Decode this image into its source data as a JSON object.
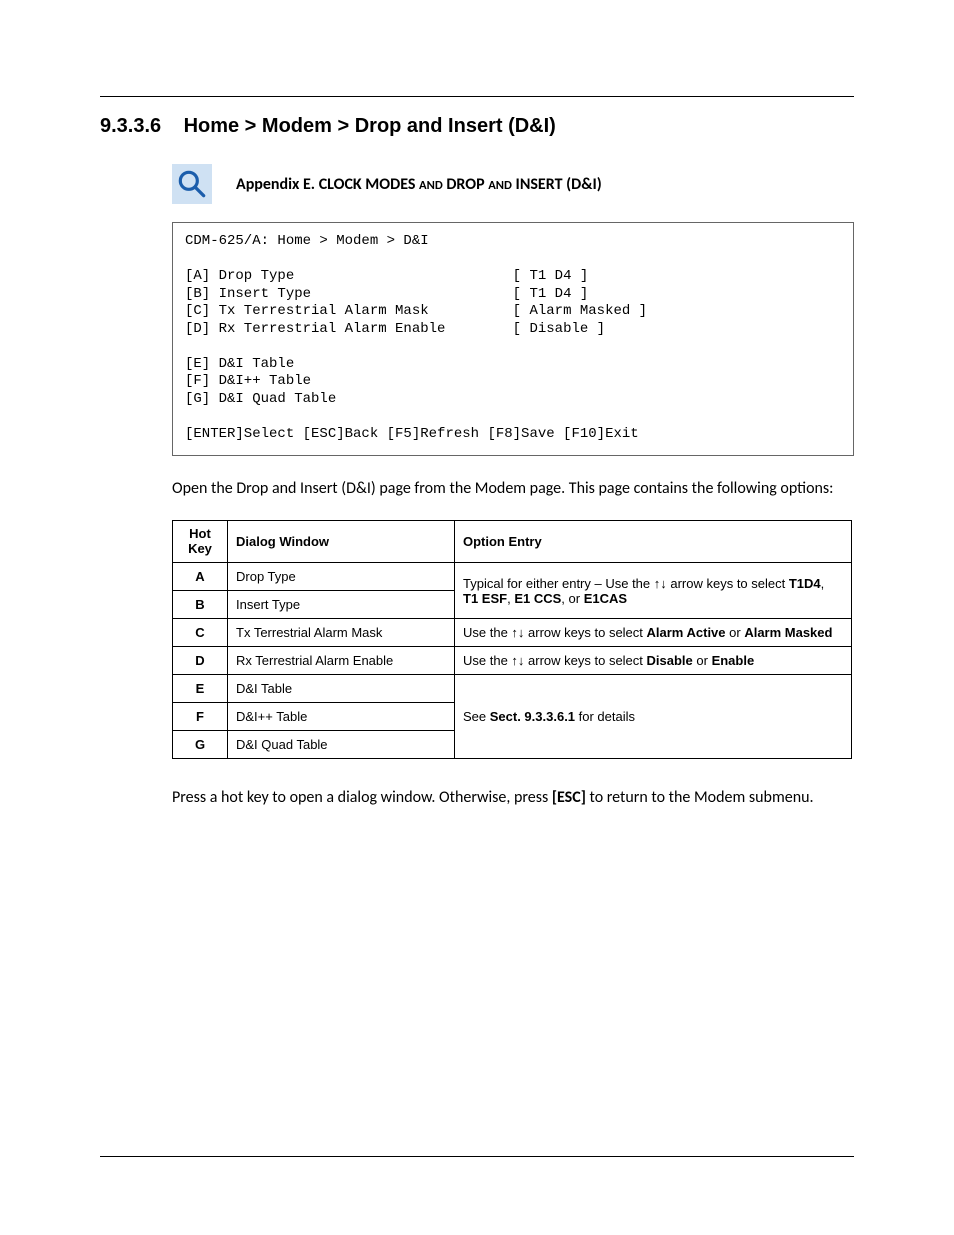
{
  "heading": {
    "number": "9.3.3.6",
    "title": "Home > Modem > Drop and Insert (D&I)"
  },
  "appendix": {
    "prefix": "Appendix E. CLOCK MODES ",
    "and1": "AND",
    "mid": " DROP ",
    "and2": "AND",
    "suffix": " INSERT (D&I)"
  },
  "terminal": {
    "line1": "CDM-625/A: Home > Modem > D&I",
    "blank": "",
    "rowA_label": "[A] Drop Type",
    "rowA_val": "[ T1 D4 ]",
    "rowB_label": "[B] Insert Type",
    "rowB_val": "[ T1 D4 ]",
    "rowC_label": "[C] Tx Terrestrial Alarm Mask",
    "rowC_val": "[ Alarm Masked ]",
    "rowD_label": "[D] Rx Terrestrial Alarm Enable",
    "rowD_val": "[ Disable ]",
    "rowE": "[E] D&I Table",
    "rowF": "[F] D&I++ Table",
    "rowG": "[G] D&I Quad Table",
    "footer": "[ENTER]Select [ESC]Back [F5]Refresh [F8]Save [F10]Exit"
  },
  "intro": "Open the Drop and Insert (D&I) page from the Modem page. This page contains the following options:",
  "table": {
    "headers": {
      "hot": "Hot Key",
      "dialog": "Dialog Window",
      "entry": "Option Entry"
    },
    "rows": [
      {
        "key": "A",
        "dialog": "Drop Type"
      },
      {
        "key": "B",
        "dialog": "Insert Type"
      },
      {
        "key": "C",
        "dialog": "Tx Terrestrial Alarm Mask"
      },
      {
        "key": "D",
        "dialog": "Rx Terrestrial Alarm Enable"
      },
      {
        "key": "E",
        "dialog": "D&I Table"
      },
      {
        "key": "F",
        "dialog": "D&I++ Table"
      },
      {
        "key": "G",
        "dialog": "D&I Quad Table"
      }
    ],
    "entryAB": {
      "pre": "Typical for either entry – Use the ↑↓ arrow keys to select ",
      "b1": "T1D4",
      "sep1": ", ",
      "b2": "T1 ESF",
      "sep2": ", ",
      "b3": "E1 CCS",
      "sep3": ", or ",
      "b4": "E1CAS"
    },
    "entryC": {
      "pre": "Use the ↑↓ arrow keys to select ",
      "b1": "Alarm Active",
      "mid": " or ",
      "b2": "Alarm Masked"
    },
    "entryD": {
      "pre": "Use the ↑↓ arrow keys to select ",
      "b1": "Disable",
      "mid": " or ",
      "b2": "Enable"
    },
    "entryEFG": {
      "pre": "See ",
      "b1": "Sect. 9.3.3.6.1",
      "post": " for details"
    }
  },
  "outro": {
    "pre": "Press a hot key to open a dialog window. Otherwise, press ",
    "esc": "[ESC]",
    "post": " to return to the Modem submenu."
  }
}
